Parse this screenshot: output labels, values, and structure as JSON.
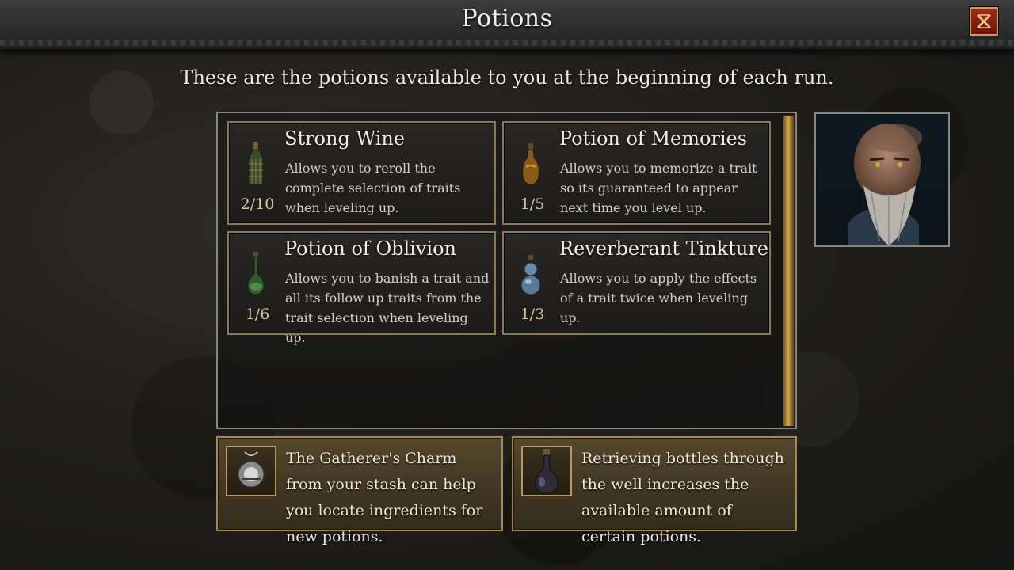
{
  "header": {
    "title": "Potions",
    "close_icon": "close-x-icon"
  },
  "subtitle": "These are the potions available to you at the beginning of each run.",
  "potions": [
    {
      "name": "Strong Wine",
      "description": "Allows you to reroll the complete selection of traits when leveling up.",
      "count": "2/10",
      "icon": "wine-bottle-icon"
    },
    {
      "name": "Potion of Memories",
      "description": "Allows you to memorize a trait so its guaranteed to appear next time you level up.",
      "count": "1/5",
      "icon": "amber-flask-icon"
    },
    {
      "name": "Potion of Oblivion",
      "description": "Allows you to  banish a trait and all its follow up traits from the trait selection when leveling up.",
      "count": "1/6",
      "icon": "green-flask-icon"
    },
    {
      "name": "Reverberant Tinkture",
      "description": "Allows you to apply the effects of a trait twice when leveling up.",
      "count": "1/3",
      "icon": "blue-double-flask-icon"
    }
  ],
  "info_panels": [
    {
      "text": "The Gatherer's Charm from your stash can help you locate ingredients for new potions.",
      "icon": "charm-icon"
    },
    {
      "text": "Retrieving bottles through the well increases the available amount of certain potions.",
      "icon": "bottle-icon"
    }
  ],
  "portrait": {
    "icon": "old-man-portrait"
  },
  "colors": {
    "gold_border": "#8f7a45",
    "scroll_gold": "#d4a84a",
    "close_red": "#a42a1a"
  }
}
